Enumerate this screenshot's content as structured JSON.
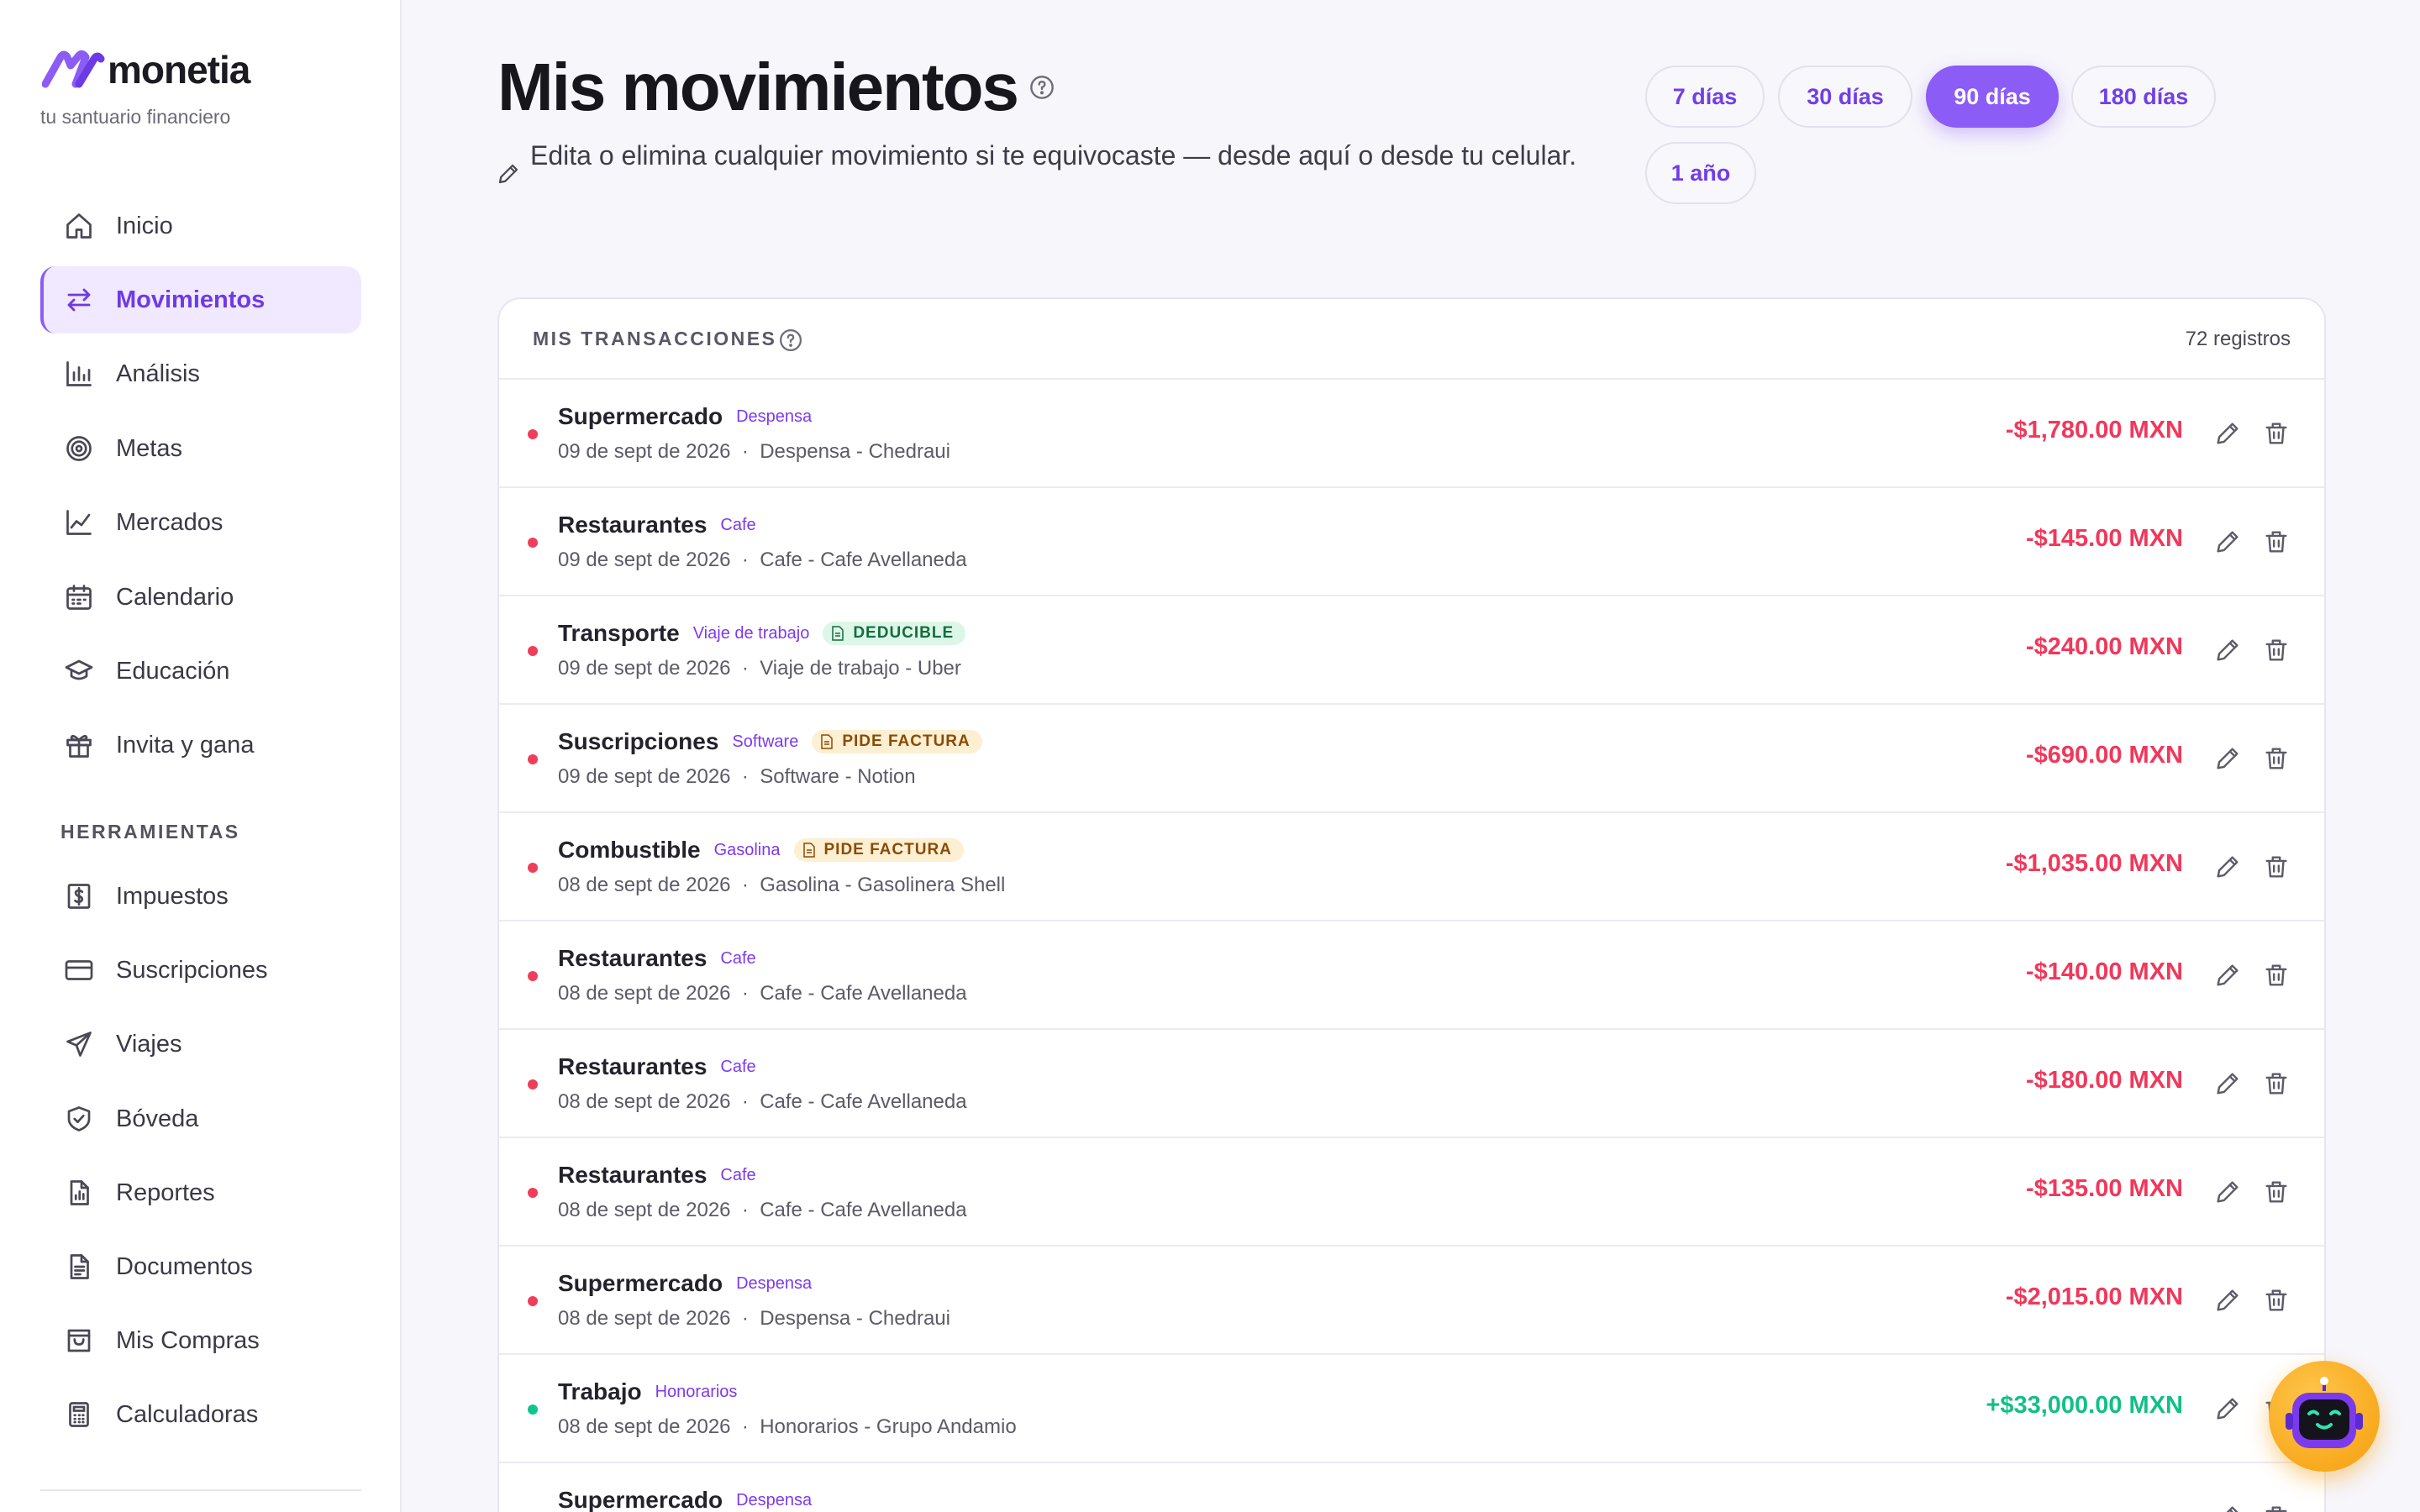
{
  "brand": {
    "name": "monetia",
    "tagline": "tu santuario financiero",
    "accent": "#8b5cf6"
  },
  "sidebar": {
    "items": [
      {
        "label": "Inicio",
        "icon": "home-icon"
      },
      {
        "label": "Movimientos",
        "icon": "arrows-swap-icon",
        "active": true
      },
      {
        "label": "Análisis",
        "icon": "bar-chart-icon"
      },
      {
        "label": "Metas",
        "icon": "target-icon"
      },
      {
        "label": "Mercados",
        "icon": "line-chart-icon"
      },
      {
        "label": "Calendario",
        "icon": "calendar-icon"
      },
      {
        "label": "Educación",
        "icon": "graduation-cap-icon"
      },
      {
        "label": "Invita y gana",
        "icon": "gift-icon"
      }
    ],
    "tools_label": "HERRAMIENTAS",
    "tools": [
      {
        "label": "Impuestos",
        "icon": "tax-receipt-icon"
      },
      {
        "label": "Suscripciones",
        "icon": "credit-card-icon"
      },
      {
        "label": "Viajes",
        "icon": "plane-icon"
      },
      {
        "label": "Bóveda",
        "icon": "shield-icon"
      },
      {
        "label": "Reportes",
        "icon": "report-icon"
      },
      {
        "label": "Documentos",
        "icon": "document-icon"
      },
      {
        "label": "Mis Compras",
        "icon": "shopping-bag-icon"
      },
      {
        "label": "Calculadoras",
        "icon": "calculator-icon"
      }
    ]
  },
  "header": {
    "title": "Mis movimientos",
    "subtitle": "Edita o elimina cualquier movimiento si te equivocaste — desde aquí o desde tu celular.",
    "ranges": [
      {
        "label": "7 días"
      },
      {
        "label": "30 días"
      },
      {
        "label": "90 días",
        "active": true
      },
      {
        "label": "180 días"
      },
      {
        "label": "1 año"
      }
    ]
  },
  "transactions": {
    "title": "MIS TRANSACCIONES",
    "count": "72 registros",
    "rows": [
      {
        "name": "Supermercado",
        "tag": "Despensa",
        "badge": "",
        "date": "09 de sept de 2026",
        "detail": "Despensa - Chedraui",
        "amount": "-$1,780.00 MXN",
        "kind": "expense"
      },
      {
        "name": "Restaurantes",
        "tag": "Cafe",
        "badge": "",
        "date": "09 de sept de 2026",
        "detail": "Cafe - Cafe Avellaneda",
        "amount": "-$145.00 MXN",
        "kind": "expense"
      },
      {
        "name": "Transporte",
        "tag": "Viaje de trabajo",
        "badge": "DEDUCIBLE",
        "badge_kind": "deducible",
        "date": "09 de sept de 2026",
        "detail": "Viaje de trabajo - Uber",
        "amount": "-$240.00 MXN",
        "kind": "expense"
      },
      {
        "name": "Suscripciones",
        "tag": "Software",
        "badge": "PIDE FACTURA",
        "badge_kind": "factura",
        "date": "09 de sept de 2026",
        "detail": "Software - Notion",
        "amount": "-$690.00 MXN",
        "kind": "expense"
      },
      {
        "name": "Combustible",
        "tag": "Gasolina",
        "badge": "PIDE FACTURA",
        "badge_kind": "factura",
        "date": "08 de sept de 2026",
        "detail": "Gasolina - Gasolinera Shell",
        "amount": "-$1,035.00 MXN",
        "kind": "expense"
      },
      {
        "name": "Restaurantes",
        "tag": "Cafe",
        "badge": "",
        "date": "08 de sept de 2026",
        "detail": "Cafe - Cafe Avellaneda",
        "amount": "-$140.00 MXN",
        "kind": "expense"
      },
      {
        "name": "Restaurantes",
        "tag": "Cafe",
        "badge": "",
        "date": "08 de sept de 2026",
        "detail": "Cafe - Cafe Avellaneda",
        "amount": "-$180.00 MXN",
        "kind": "expense"
      },
      {
        "name": "Restaurantes",
        "tag": "Cafe",
        "badge": "",
        "date": "08 de sept de 2026",
        "detail": "Cafe - Cafe Avellaneda",
        "amount": "-$135.00 MXN",
        "kind": "expense"
      },
      {
        "name": "Supermercado",
        "tag": "Despensa",
        "badge": "",
        "date": "08 de sept de 2026",
        "detail": "Despensa - Chedraui",
        "amount": "-$2,015.00 MXN",
        "kind": "expense"
      },
      {
        "name": "Trabajo",
        "tag": "Honorarios",
        "badge": "",
        "date": "08 de sept de 2026",
        "detail": "Honorarios - Grupo Andamio",
        "amount": "+$33,000.00 MXN",
        "kind": "income"
      },
      {
        "name": "Supermercado",
        "tag": "Despensa",
        "badge": "",
        "date": "",
        "detail": "",
        "amount": "",
        "kind": "expense"
      }
    ]
  },
  "colors": {
    "expense": "#f0385b",
    "income": "#13bf87",
    "deducible_bg": "#dcf7e7",
    "factura_bg": "#fdefd2"
  }
}
